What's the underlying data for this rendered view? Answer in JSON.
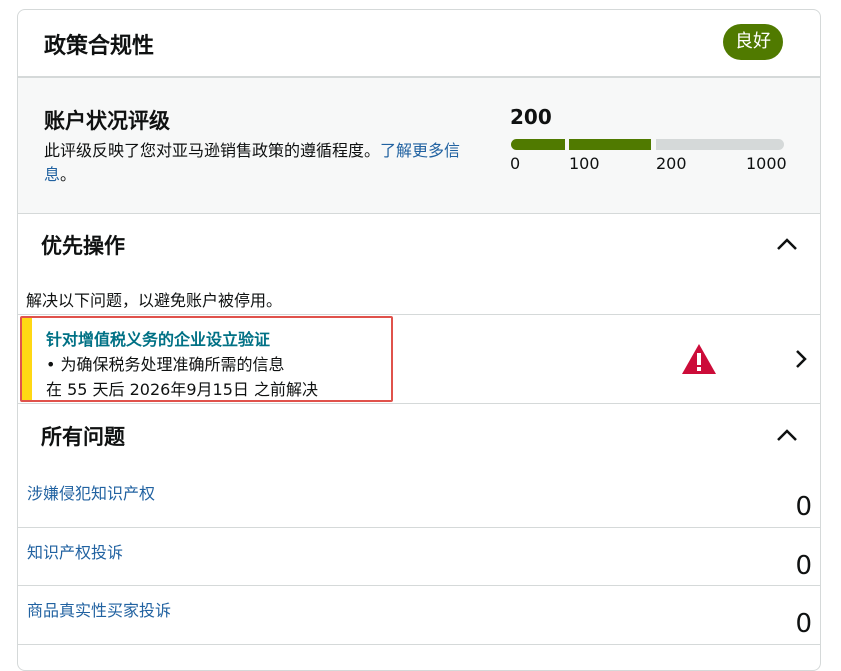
{
  "header": {
    "title": "政策合规性",
    "status_badge": "良好"
  },
  "rating": {
    "title": "账户状况评级",
    "description": "此评级反映了您对亚马逊销售政策的遵循程度。",
    "learn_more": "了解更多信息",
    "period": "。",
    "score": "200",
    "score_value": 200,
    "ticks": [
      "0",
      "100",
      "200",
      "1000"
    ]
  },
  "priority": {
    "title": "优先操作",
    "subtitle": "解决以下问题，以避免账户被停用。",
    "issue": {
      "title": "针对增值税义务的企业设立验证",
      "detail": "• 为确保税务处理准确所需的信息",
      "deadline": "在 55 天后 2026年9月15日 之前解决"
    }
  },
  "all_issues": {
    "title": "所有问题",
    "items": [
      {
        "label": "涉嫌侵犯知识产权",
        "count": "0"
      },
      {
        "label": "知识产权投诉",
        "count": "0"
      },
      {
        "label": "商品真实性买家投诉",
        "count": "0"
      }
    ]
  },
  "colors": {
    "good": "#507a00",
    "link": "#2162a1",
    "warning": "#cc0c39",
    "stripe": "#ffd814",
    "highlight": "#e0524b"
  }
}
